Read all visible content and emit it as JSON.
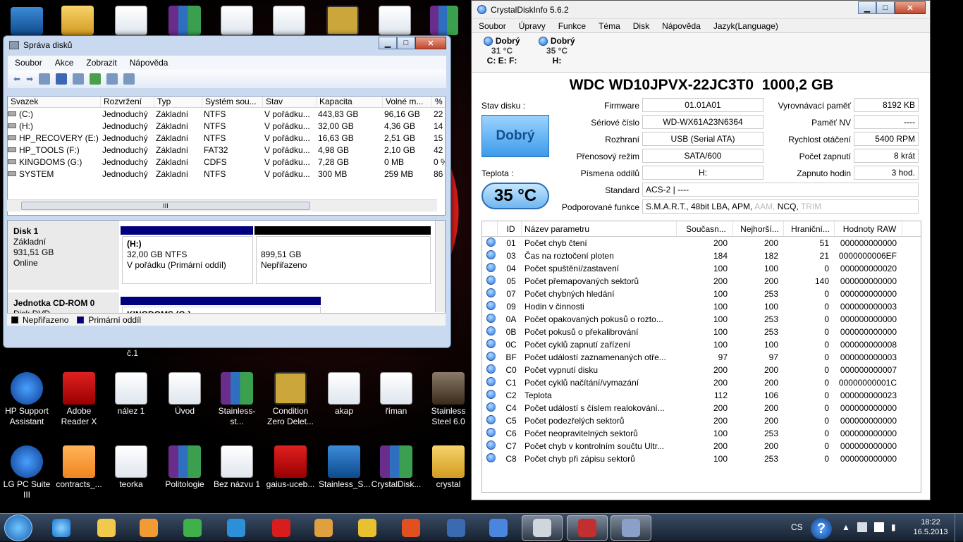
{
  "desktop": {
    "top_icons": [
      "",
      "",
      "",
      "",
      "",
      "",
      "",
      "",
      ""
    ],
    "row1": [
      {
        "label": "HP Support Assistant",
        "icon": "help-icon"
      },
      {
        "label": "Adobe Reader X",
        "icon": "pdf-icon"
      },
      {
        "label": "nález 1",
        "icon": "document-icon"
      },
      {
        "label": "Úvod",
        "icon": "document-icon"
      },
      {
        "label": "Stainless-st...",
        "icon": "rar-icon"
      },
      {
        "label": "Condition Zero Delet...",
        "icon": "counter-strike-icon"
      },
      {
        "label": "akap",
        "icon": "word-document-icon"
      },
      {
        "label": "říman",
        "icon": "word-document-icon"
      },
      {
        "label": "Stainless Steel 6.0",
        "icon": "stainless-steel-icon"
      }
    ],
    "row2": [
      {
        "label": "LG PC Suite III",
        "icon": "lg-suite-icon"
      },
      {
        "label": "contracts_...",
        "icon": "orange-file-icon"
      },
      {
        "label": "teorka",
        "icon": "document-icon"
      },
      {
        "label": "Politologie",
        "icon": "rar-icon"
      },
      {
        "label": "Bez názvu 1",
        "icon": "word-document-icon"
      },
      {
        "label": "gaius-uceb...",
        "icon": "pdf-icon"
      },
      {
        "label": "Stainless_S...",
        "icon": "installer-icon"
      },
      {
        "label": "CrystalDisk...",
        "icon": "rar-icon"
      },
      {
        "label": "crystal",
        "icon": "folder-icon"
      }
    ],
    "misc_label": "č.1"
  },
  "diskmgmt": {
    "title": "Správa disků",
    "menu": [
      "Soubor",
      "Akce",
      "Zobrazit",
      "Nápověda"
    ],
    "columns": [
      "Svazek",
      "Rozvržení",
      "Typ",
      "Systém sou...",
      "Stav",
      "Kapacita",
      "Volné m...",
      "%"
    ],
    "rows": [
      [
        "(C:)",
        "Jednoduchý",
        "Základní",
        "NTFS",
        "V pořádku...",
        "443,83 GB",
        "96,16 GB",
        "22"
      ],
      [
        "(H:)",
        "Jednoduchý",
        "Základní",
        "NTFS",
        "V pořádku...",
        "32,00 GB",
        "4,36 GB",
        "14"
      ],
      [
        "HP_RECOVERY (E:)",
        "Jednoduchý",
        "Základní",
        "NTFS",
        "V pořádku...",
        "16,63 GB",
        "2,51 GB",
        "15"
      ],
      [
        "HP_TOOLS (F:)",
        "Jednoduchý",
        "Základní",
        "FAT32",
        "V pořádku...",
        "4,98 GB",
        "2,10 GB",
        "42"
      ],
      [
        "KINGDOMS (G:)",
        "Jednoduchý",
        "Základní",
        "CDFS",
        "V pořádku...",
        "7,28 GB",
        "0 MB",
        "0 %"
      ],
      [
        "SYSTEM",
        "Jednoduchý",
        "Základní",
        "NTFS",
        "V pořádku...",
        "300 MB",
        "259 MB",
        "86"
      ]
    ],
    "disk1": {
      "name": "Disk 1",
      "type": "Základní",
      "size": "931,51 GB",
      "status": "Online"
    },
    "part_h": {
      "name": "(H:)",
      "size": "32,00 GB NTFS",
      "status": "V pořádku (Primární oddíl)"
    },
    "part_un": {
      "size": "899,51 GB",
      "status": "Nepřiřazeno"
    },
    "cdrom": {
      "name": "Jednotka CD-ROM 0",
      "type": "Disk DVD",
      "part": "KINGDOMS (G:)"
    },
    "legend": {
      "unallocated": "Nepřiřazeno",
      "primary": "Primární oddíl"
    },
    "scroll_mark": "III"
  },
  "crystal": {
    "title": "CrystalDiskInfo 5.6.2",
    "menu": [
      "Soubor",
      "Úpravy",
      "Funkce",
      "Téma",
      "Disk",
      "Nápověda",
      "Jazyk(Language)"
    ],
    "drives": [
      {
        "status": "Dobrý",
        "temp": "31 °C",
        "letters": "C: E: F:"
      },
      {
        "status": "Dobrý",
        "temp": "35 °C",
        "letters": "H:"
      }
    ],
    "model": "WDC WD10JPVX-22JC3T0  1000,2 GB",
    "health_label": "Stav disku :",
    "health": "Dobrý",
    "temp_label": "Teplota :",
    "temp": "35 °C",
    "fields": {
      "firmware_l": "Firmware",
      "firmware": "01.01A01",
      "serial_l": "Sériové číslo",
      "serial": "WD-WX61A23N6364",
      "interface_l": "Rozhraní",
      "interface": "USB (Serial ATA)",
      "transfer_l": "Přenosový režim",
      "transfer": "SATA/600",
      "letters_l": "Písmena oddílů",
      "letters": "H:",
      "standard_l": "Standard",
      "standard": "ACS-2 | ----",
      "features_l": "Podporované funkce",
      "features": "S.M.A.R.T., 48bit LBA, APM,",
      "features_dim1": "AAM,",
      "features_mid": "NCQ,",
      "features_dim2": "TRIM",
      "buffer_l": "Vyrovnávací paměť",
      "buffer": "8192 KB",
      "nv_l": "Paměť NV",
      "nv": "----",
      "rpm_l": "Rychlost otáčení",
      "rpm": "5400 RPM",
      "count_l": "Počet zapnutí",
      "count": "8 krát",
      "hours_l": "Zapnuto hodin",
      "hours": "3 hod."
    },
    "smart_cols": [
      "ID",
      "Název parametru",
      "Současn...",
      "Nejhorší...",
      "Hraniční...",
      "Hodnoty RAW"
    ],
    "smart": [
      [
        "01",
        "Počet chyb čtení",
        "200",
        "200",
        "51",
        "000000000000"
      ],
      [
        "03",
        "Čas na roztočení ploten",
        "184",
        "182",
        "21",
        "0000000006EF"
      ],
      [
        "04",
        "Počet spuštění/zastavení",
        "100",
        "100",
        "0",
        "000000000020"
      ],
      [
        "05",
        "Počet přemapovaných sektorů",
        "200",
        "200",
        "140",
        "000000000000"
      ],
      [
        "07",
        "Počet chybných hledání",
        "100",
        "253",
        "0",
        "000000000000"
      ],
      [
        "09",
        "Hodin v činnosti",
        "100",
        "100",
        "0",
        "000000000003"
      ],
      [
        "0A",
        "Počet opakovaných pokusů o rozto...",
        "100",
        "253",
        "0",
        "000000000000"
      ],
      [
        "0B",
        "Počet pokusů o překalibrování",
        "100",
        "253",
        "0",
        "000000000000"
      ],
      [
        "0C",
        "Počet cyklů zapnutí zařízení",
        "100",
        "100",
        "0",
        "000000000008"
      ],
      [
        "BF",
        "Počet událostí zaznamenaných otře...",
        "97",
        "97",
        "0",
        "000000000003"
      ],
      [
        "C0",
        "Počet vypnutí disku",
        "200",
        "200",
        "0",
        "000000000007"
      ],
      [
        "C1",
        "Počet cyklů načítání/vymazání",
        "200",
        "200",
        "0",
        "00000000001C"
      ],
      [
        "C2",
        "Teplota",
        "112",
        "106",
        "0",
        "000000000023"
      ],
      [
        "C4",
        "Počet událostí s číslem realokování...",
        "200",
        "200",
        "0",
        "000000000000"
      ],
      [
        "C5",
        "Počet podezřelých sektorů",
        "200",
        "200",
        "0",
        "000000000000"
      ],
      [
        "C6",
        "Počet neopravitelných sektorů",
        "100",
        "253",
        "0",
        "000000000000"
      ],
      [
        "C7",
        "Počet chyb v kontrolním součtu Ultr...",
        "200",
        "200",
        "0",
        "000000000000"
      ],
      [
        "C8",
        "Počet chyb při zápisu sektorů",
        "100",
        "253",
        "0",
        "000000000000"
      ]
    ]
  },
  "taskbar": {
    "lang": "CS",
    "time": "18:22",
    "date": "16.5.2013",
    "apps": [
      "explorer-icon",
      "media-player-icon",
      "stock-icon",
      "wifi-icon",
      "opera-icon",
      "mail-icon",
      "chrome-icon",
      "tools-icon",
      "kmplayer-icon",
      "google-earth-icon",
      "print-icon",
      "toolbox-icon",
      "crystaldiskinfo-icon"
    ]
  }
}
